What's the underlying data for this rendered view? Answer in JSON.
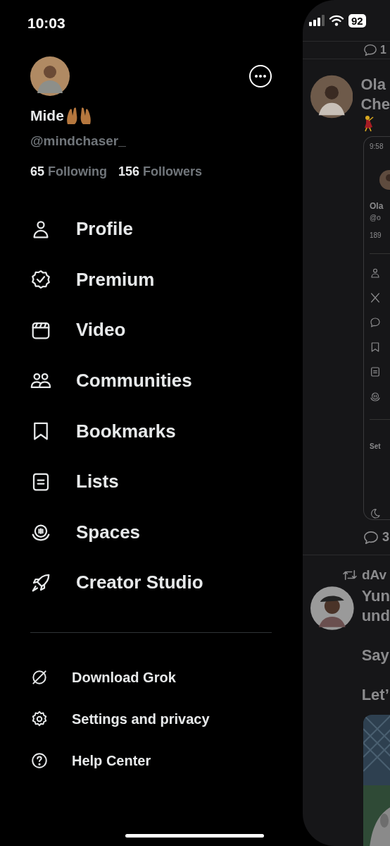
{
  "status_bar": {
    "time": "10:03",
    "battery": "92"
  },
  "profile": {
    "name": "Mide",
    "handle": "@mindchaser_",
    "following_count": "65",
    "following_label": "Following",
    "followers_count": "156",
    "followers_label": "Followers"
  },
  "menu": [
    {
      "label": "Profile"
    },
    {
      "label": "Premium"
    },
    {
      "label": "Video"
    },
    {
      "label": "Communities"
    },
    {
      "label": "Bookmarks"
    },
    {
      "label": "Lists"
    },
    {
      "label": "Spaces"
    },
    {
      "label": "Creator Studio"
    }
  ],
  "secondary_menu": [
    {
      "label": "Download Grok"
    },
    {
      "label": "Settings and privacy"
    },
    {
      "label": "Help Center"
    }
  ],
  "feed": {
    "top_reply_count": "1",
    "post": {
      "author_line1": "Ola",
      "author_line2": "Che",
      "screenshot": {
        "time": "9:58",
        "name": "Ola",
        "handle": "@o",
        "count": "189",
        "section": "Set"
      },
      "reply_count": "3"
    },
    "repost": {
      "reposter": "dAv",
      "lines": [
        "Yun",
        "und",
        "Say",
        "Let’"
      ]
    }
  }
}
